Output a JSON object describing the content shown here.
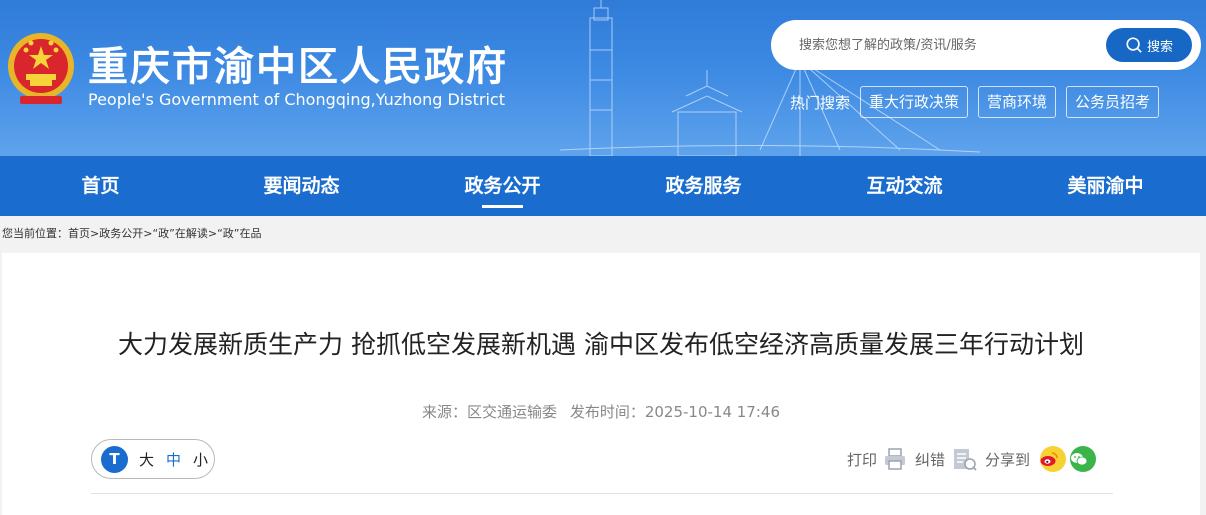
{
  "header": {
    "site_title": "重庆市渝中区人民政府",
    "site_subtitle": "People's Government of Chongqing,Yuzhong District",
    "search": {
      "placeholder": "搜索您想了解的政策/资讯/服务",
      "button_label": "搜索"
    },
    "hot": {
      "label": "热门搜索",
      "links": [
        "重大行政决策",
        "营商环境",
        "公务员招考"
      ]
    }
  },
  "nav": {
    "items": [
      "首页",
      "要闻动态",
      "政务公开",
      "政务服务",
      "互动交流",
      "美丽渝中"
    ],
    "active": "政务公开"
  },
  "breadcrumb": {
    "prefix": "您当前位置：",
    "items": [
      "首页",
      "政务公开",
      "“政”在解读",
      "“政”在品"
    ],
    "separator": ">"
  },
  "article": {
    "title": "大力发展新质生产力 抢抓低空发展新机遇 渝中区发布低空经济高质量发展三年行动计划",
    "source": "来源：区交通运输委",
    "published": "发布时间：2025-10-14 17:46",
    "font_size": {
      "icon_glyph": "T",
      "large": "大",
      "medium": "中",
      "small": "小",
      "selected": "中"
    },
    "tools": {
      "print": "打印",
      "correct": "纠错",
      "share": "分享到"
    }
  },
  "colors": {
    "header_blue": "#2f7bd8",
    "nav_blue": "#1a6dce",
    "search_button": "#1767c4",
    "weibo": "#f6d233",
    "wechat": "#3bb54a"
  },
  "icons": [
    "national-emblem-icon",
    "search-icon",
    "font-size-icon",
    "print-icon",
    "correct-icon",
    "weibo-icon",
    "wechat-icon"
  ]
}
